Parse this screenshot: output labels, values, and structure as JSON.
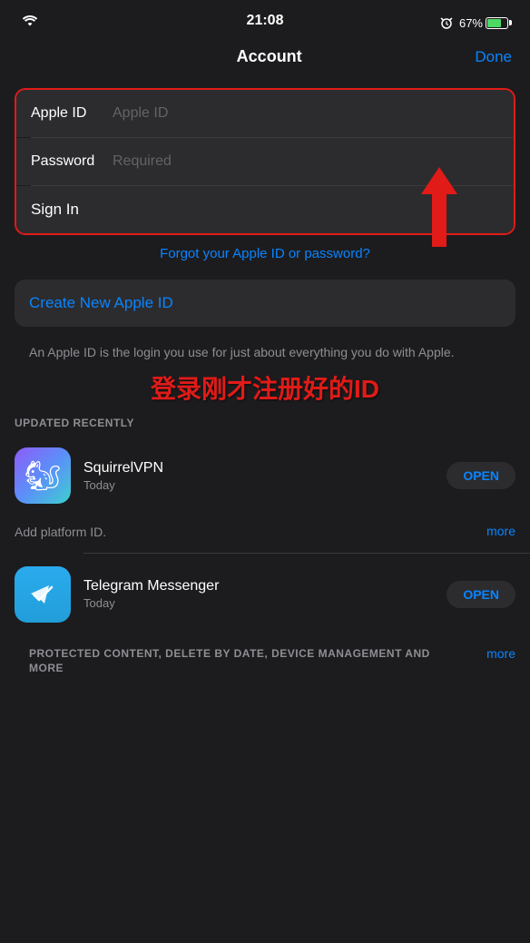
{
  "status_bar": {
    "time": "21:08",
    "battery_percent": "67%"
  },
  "header": {
    "title": "Account",
    "done_label": "Done"
  },
  "form": {
    "apple_id_label": "Apple ID",
    "apple_id_placeholder": "Apple ID",
    "password_label": "Password",
    "password_placeholder": "Required",
    "signin_label": "Sign In"
  },
  "links": {
    "forgot": "Forgot your Apple ID or password?",
    "create_new": "Create New Apple ID",
    "description": "An Apple ID is the login you use for just about everything you do with Apple.",
    "updated_recently": "UPDATED RECENTLY"
  },
  "overlay": {
    "chinese_text": "登录刚才注册好的ID"
  },
  "apps": [
    {
      "name": "SquirrelVPN",
      "date": "Today",
      "open_label": "OPEN",
      "more_desc": "Add platform ID.",
      "more_label": "more"
    },
    {
      "name": "Telegram Messenger",
      "date": "Today",
      "open_label": "OPEN",
      "protected_desc": "PROTECTED CONTENT, DELETE BY DATE, DEVICE MANAGEMENT AND MORE",
      "more_label": "more"
    }
  ]
}
